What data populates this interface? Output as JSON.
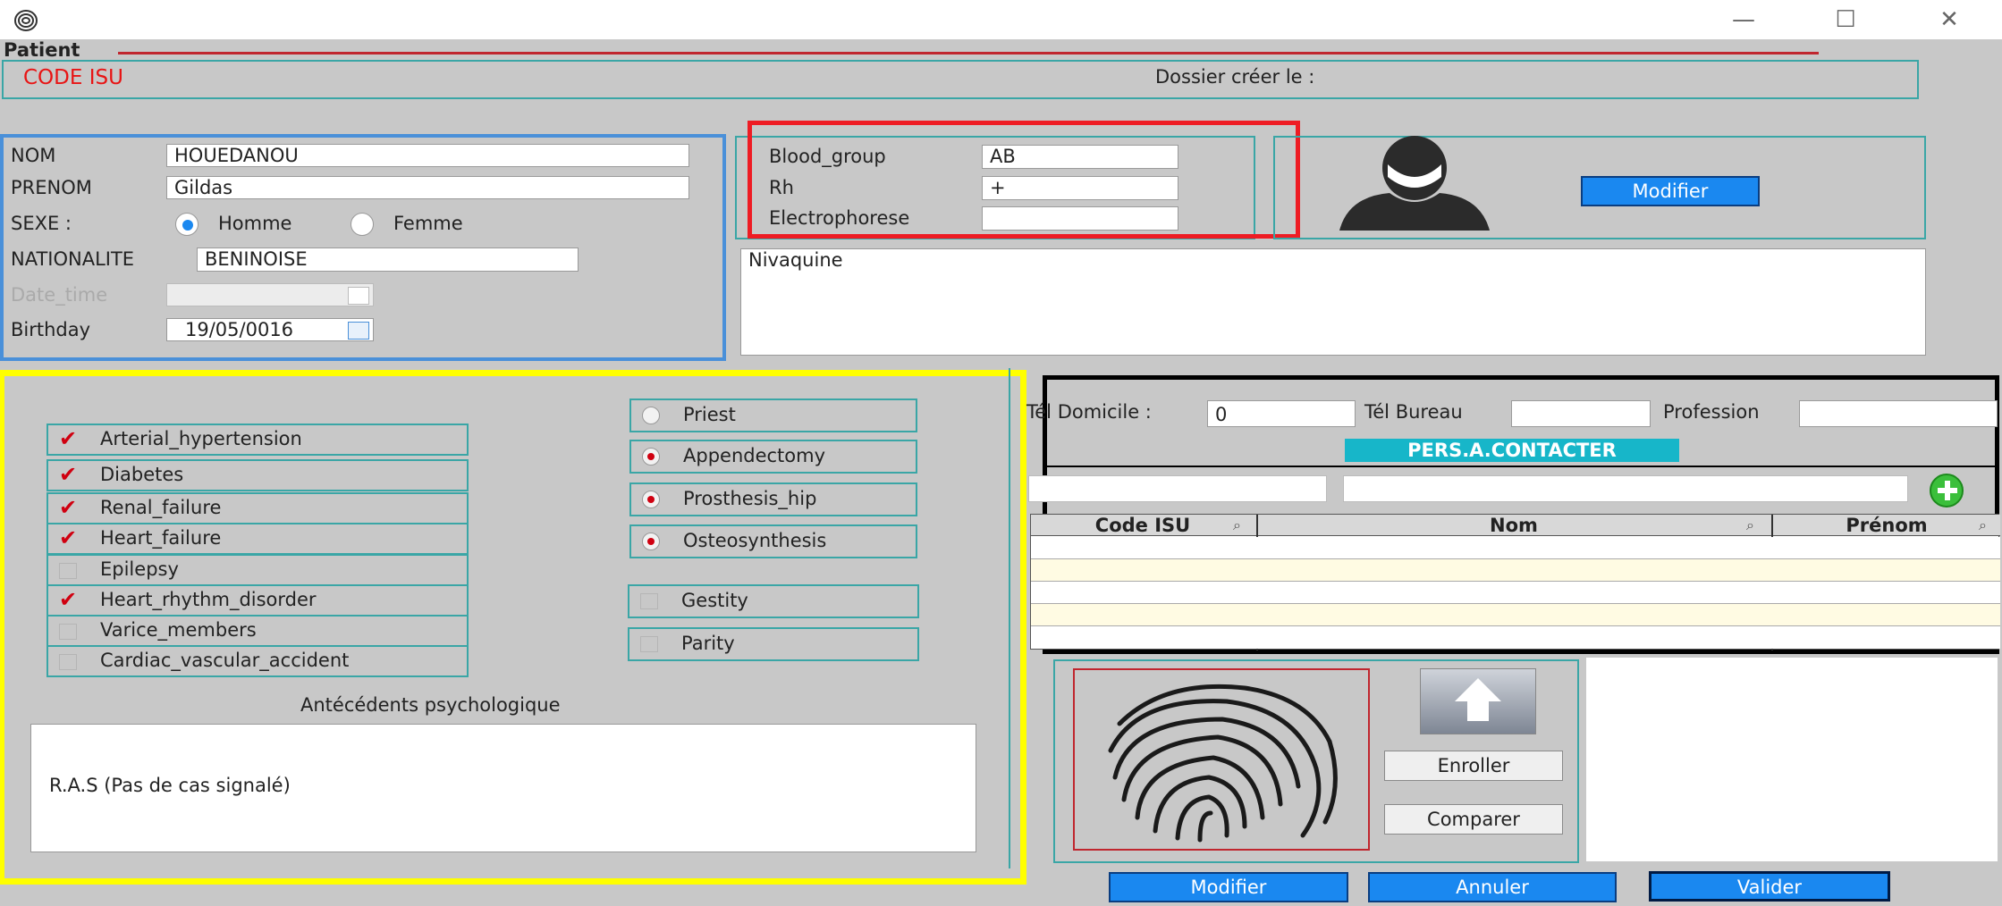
{
  "window": {
    "app_icon": "fingerprint-icon",
    "minimize": "—",
    "maximize": "☐",
    "close": "✕"
  },
  "header": {
    "tab": "Patient",
    "code_isu": "CODE ISU",
    "dossier": "Dossier créer le :"
  },
  "identity": {
    "nom_label": "NOM",
    "nom_value": "HOUEDANOU",
    "prenom_label": "PRENOM",
    "prenom_value": "Gildas",
    "sexe_label": "SEXE :",
    "homme": "Homme",
    "femme": "Femme",
    "nationalite_label": "NATIONALITE",
    "nationalite_value": "BENINOISE",
    "date_time_label": "Date_time",
    "birthday_label": "Birthday",
    "birthday_value": "19/05/0016"
  },
  "blood": {
    "group_label": "Blood_group",
    "group_value": "AB",
    "rh_label": "Rh",
    "rh_value": "+",
    "electro_label": "Electrophorese",
    "electro_value": ""
  },
  "photo": {
    "modifier": "Modifier"
  },
  "notes": {
    "value": "Nivaquine"
  },
  "antecedents": {
    "checks": [
      {
        "label": "Arterial_hypertension",
        "checked": true
      },
      {
        "label": "Diabetes",
        "checked": true
      },
      {
        "label": "Renal_failure",
        "checked": true
      },
      {
        "label": "Heart_failure",
        "checked": true
      },
      {
        "label": "Epilepsy",
        "checked": false
      },
      {
        "label": "Heart_rhythm_disorder",
        "checked": true
      },
      {
        "label": "Varice_members",
        "checked": false
      },
      {
        "label": "Cardiac_vascular_accident",
        "checked": false
      }
    ],
    "options": [
      {
        "label": "Priest",
        "selected": false
      },
      {
        "label": "Appendectomy",
        "selected": true
      },
      {
        "label": "Prosthesis_hip",
        "selected": true
      },
      {
        "label": "Osteosynthesis",
        "selected": true
      }
    ],
    "gestity": "Gestity",
    "parity": "Parity",
    "psy_title": "Antécédents psychologique",
    "psy_value": "R.A.S (Pas de cas  signalé)"
  },
  "contact": {
    "tel_dom_label": "Tél Domicile :",
    "tel_dom_value": "0",
    "tel_bur_label": "Tél Bureau",
    "tel_bur_value": "",
    "profession_label": "Profession",
    "profession_value": "",
    "pers_title": "PERS.A.CONTACTER",
    "add_icon": "plus-icon",
    "columns": [
      "Code ISU",
      "Nom",
      "Prénom"
    ]
  },
  "biometric": {
    "enroller": "Enroller",
    "comparer": "Comparer",
    "arrow_icon": "arrow-up-icon"
  },
  "footer": {
    "modifier": "Modifier",
    "annuler": "Annuler",
    "valider": "Valider"
  },
  "colors": {
    "highlight_blue": "#4a90d9",
    "highlight_red": "#ee1c24",
    "highlight_yellow": "#ffff00",
    "highlight_black": "#000000",
    "teal": "#3aa6a6",
    "button_blue": "#1a88f0",
    "check_red": "#d00010"
  }
}
